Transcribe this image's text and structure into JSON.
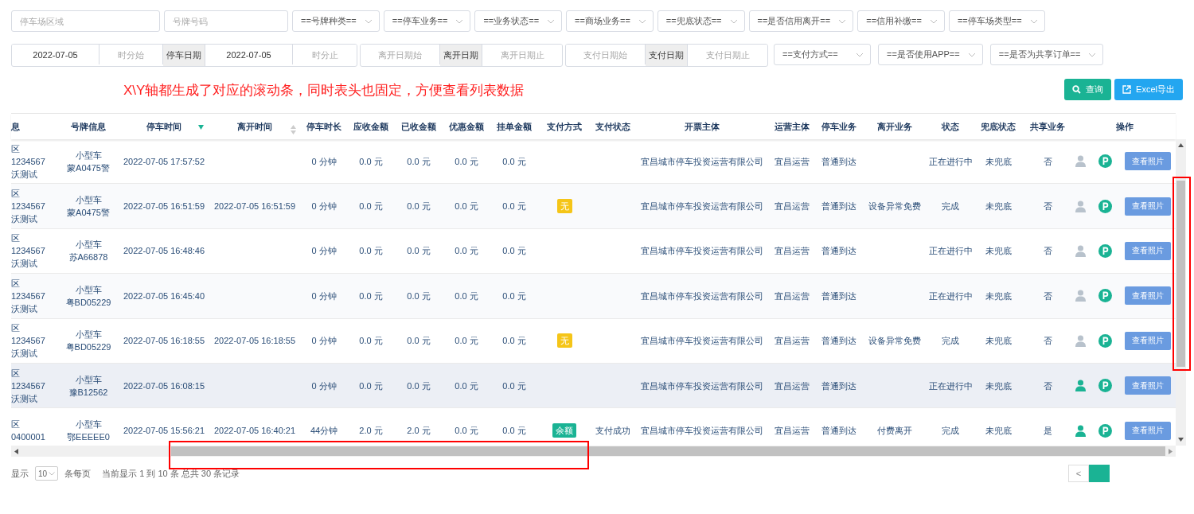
{
  "filters_row_1": [
    {
      "kind": "input",
      "placeholder": "停车场区域"
    },
    {
      "kind": "input",
      "placeholder": "号牌号码"
    },
    {
      "kind": "select",
      "value": "==号牌种类=="
    },
    {
      "kind": "select",
      "value": "==停车业务=="
    },
    {
      "kind": "select",
      "value": "==业务状态=="
    },
    {
      "kind": "select",
      "value": "==商场业务=="
    },
    {
      "kind": "select",
      "value": "==兜底状态=="
    },
    {
      "kind": "select",
      "value": "==是否信用离开=="
    },
    {
      "kind": "select",
      "value": "==信用补缴=="
    },
    {
      "kind": "select",
      "value": "==停车场类型=="
    }
  ],
  "filters_row_2": [
    {
      "kind": "range",
      "parts": [
        {
          "kind": "input",
          "value": "2022-07-05"
        },
        {
          "kind": "input",
          "placeholder": "时分始"
        },
        {
          "kind": "addon",
          "label": "停车日期"
        },
        {
          "kind": "input",
          "value": "2022-07-05"
        },
        {
          "kind": "input",
          "placeholder": "时分止"
        }
      ]
    },
    {
      "kind": "range",
      "parts": [
        {
          "kind": "input",
          "placeholder": "离开日期始"
        },
        {
          "kind": "addon",
          "label": "离开日期"
        },
        {
          "kind": "input",
          "placeholder": "离开日期止"
        }
      ]
    },
    {
      "kind": "range",
      "parts": [
        {
          "kind": "input",
          "placeholder": "支付日期始"
        },
        {
          "kind": "addon",
          "label": "支付日期"
        },
        {
          "kind": "input",
          "placeholder": "支付日期止"
        }
      ]
    },
    {
      "kind": "select",
      "value": "==支付方式=="
    },
    {
      "kind": "select",
      "value": "==是否使用APP=="
    },
    {
      "kind": "select",
      "value": "==是否为共享订单=="
    }
  ],
  "annotation": "X\\Y轴都生成了对应的滚动条，同时表头也固定，方便查看列表数据",
  "buttons": [
    {
      "kind": "search",
      "label": "查询"
    },
    {
      "kind": "export",
      "label": "Excel导出"
    }
  ],
  "table": {
    "columns": [
      {
        "label": "息"
      },
      {
        "label": "号牌信息"
      },
      {
        "label": "停车时间",
        "sorted": true
      },
      {
        "label": "离开时间",
        "sorted": false
      },
      {
        "label": "停车时长"
      },
      {
        "label": "应收金额"
      },
      {
        "label": "已收金额"
      },
      {
        "label": "优惠金额"
      },
      {
        "label": "挂单金额"
      },
      {
        "label": "支付方式"
      },
      {
        "label": "支付状态"
      },
      {
        "label": "开票主体"
      },
      {
        "label": "运营主体"
      },
      {
        "label": "停车业务"
      },
      {
        "label": "离开业务"
      },
      {
        "label": "状态"
      },
      {
        "label": "兜底状态"
      },
      {
        "label": "共享业务"
      },
      {
        "label": "操作"
      }
    ],
    "rows": [
      {
        "highlighted": false,
        "lot": [
          "区",
          "1234567",
          "沃测试"
        ],
        "vehicle": [
          "小型车",
          "蒙A0475警"
        ],
        "enter": "2022-07-05 17:57:52",
        "leave": "",
        "duration": "0 分钟",
        "due": "0.0 元",
        "paid": "0.0 元",
        "discount": "0.0 元",
        "pending": "0.0 元",
        "pay_method": null,
        "pay_status": "",
        "issuer": "宜昌城市停车投资运营有限公司",
        "operator": "宜昌运营",
        "park_biz": "普通到达",
        "leave_biz": "",
        "status": "正在进行中",
        "fallback": "未兜底",
        "shared": "否",
        "app_user": false,
        "action": "查看照片"
      },
      {
        "highlighted": false,
        "lot": [
          "区",
          "1234567",
          "沃测试"
        ],
        "vehicle": [
          "小型车",
          "蒙A0475警"
        ],
        "enter": "2022-07-05 16:51:59",
        "leave": "2022-07-05 16:51:59",
        "duration": "0 分钟",
        "due": "0.0 元",
        "paid": "0.0 元",
        "discount": "0.0 元",
        "pending": "0.0 元",
        "pay_method": {
          "label": "无",
          "color": "#f5c518"
        },
        "pay_status": "",
        "issuer": "宜昌城市停车投资运营有限公司",
        "operator": "宜昌运营",
        "park_biz": "普通到达",
        "leave_biz": "设备异常免费",
        "status": "完成",
        "fallback": "未兜底",
        "shared": "否",
        "app_user": false,
        "action": "查看照片"
      },
      {
        "highlighted": false,
        "lot": [
          "区",
          "1234567",
          "沃测试"
        ],
        "vehicle": [
          "小型车",
          "苏A66878"
        ],
        "enter": "2022-07-05 16:48:46",
        "leave": "",
        "duration": "0 分钟",
        "due": "0.0 元",
        "paid": "0.0 元",
        "discount": "0.0 元",
        "pending": "0.0 元",
        "pay_method": null,
        "pay_status": "",
        "issuer": "宜昌城市停车投资运营有限公司",
        "operator": "宜昌运营",
        "park_biz": "普通到达",
        "leave_biz": "",
        "status": "正在进行中",
        "fallback": "未兜底",
        "shared": "否",
        "app_user": false,
        "action": "查看照片"
      },
      {
        "highlighted": false,
        "lot": [
          "区",
          "1234567",
          "沃测试"
        ],
        "vehicle": [
          "小型车",
          "粤BD05229"
        ],
        "enter": "2022-07-05 16:45:40",
        "leave": "",
        "duration": "0 分钟",
        "due": "0.0 元",
        "paid": "0.0 元",
        "discount": "0.0 元",
        "pending": "0.0 元",
        "pay_method": null,
        "pay_status": "",
        "issuer": "宜昌城市停车投资运营有限公司",
        "operator": "宜昌运营",
        "park_biz": "普通到达",
        "leave_biz": "",
        "status": "正在进行中",
        "fallback": "未兜底",
        "shared": "否",
        "app_user": false,
        "action": "查看照片"
      },
      {
        "highlighted": false,
        "lot": [
          "区",
          "1234567",
          "沃测试"
        ],
        "vehicle": [
          "小型车",
          "粤BD05229"
        ],
        "enter": "2022-07-05 16:18:55",
        "leave": "2022-07-05 16:18:55",
        "duration": "0 分钟",
        "due": "0.0 元",
        "paid": "0.0 元",
        "discount": "0.0 元",
        "pending": "0.0 元",
        "pay_method": {
          "label": "无",
          "color": "#f5c518"
        },
        "pay_status": "",
        "issuer": "宜昌城市停车投资运营有限公司",
        "operator": "宜昌运营",
        "park_biz": "普通到达",
        "leave_biz": "设备异常免费",
        "status": "完成",
        "fallback": "未兜底",
        "shared": "否",
        "app_user": false,
        "action": "查看照片"
      },
      {
        "highlighted": true,
        "lot": [
          "区",
          "1234567",
          "沃测试"
        ],
        "vehicle": [
          "小型车",
          "豫B12562"
        ],
        "enter": "2022-07-05 16:08:15",
        "leave": "",
        "duration": "0 分钟",
        "due": "0.0 元",
        "paid": "0.0 元",
        "discount": "0.0 元",
        "pending": "0.0 元",
        "pay_method": null,
        "pay_status": "",
        "issuer": "宜昌城市停车投资运营有限公司",
        "operator": "宜昌运营",
        "park_biz": "普通到达",
        "leave_biz": "",
        "status": "正在进行中",
        "fallback": "未兜底",
        "shared": "否",
        "app_user": true,
        "action": "查看照片"
      },
      {
        "highlighted": false,
        "lot": [
          "区",
          "0400001"
        ],
        "vehicle": [
          "小型车",
          "鄂EEEEE0"
        ],
        "enter": "2022-07-05 15:56:21",
        "leave": "2022-07-05 16:40:21",
        "duration": "44分钟",
        "due": "2.0 元",
        "paid": "2.0 元",
        "discount": "0.0 元",
        "pending": "0.0 元",
        "pay_method": {
          "label": "余额",
          "color": "#1ab394"
        },
        "pay_status": "支付成功",
        "issuer": "宜昌城市停车投资运营有限公司",
        "operator": "宜昌运营",
        "park_biz": "普通到达",
        "leave_biz": "付费离开",
        "status": "完成",
        "fallback": "未兜底",
        "shared": "是",
        "app_user": true,
        "action": "查看照片"
      }
    ]
  },
  "footer": {
    "show": "显示",
    "page_size": "10",
    "per_page": "条每页",
    "summary": "当前显示 1 到 10 条 总共 30 条记录",
    "prev": "<"
  }
}
